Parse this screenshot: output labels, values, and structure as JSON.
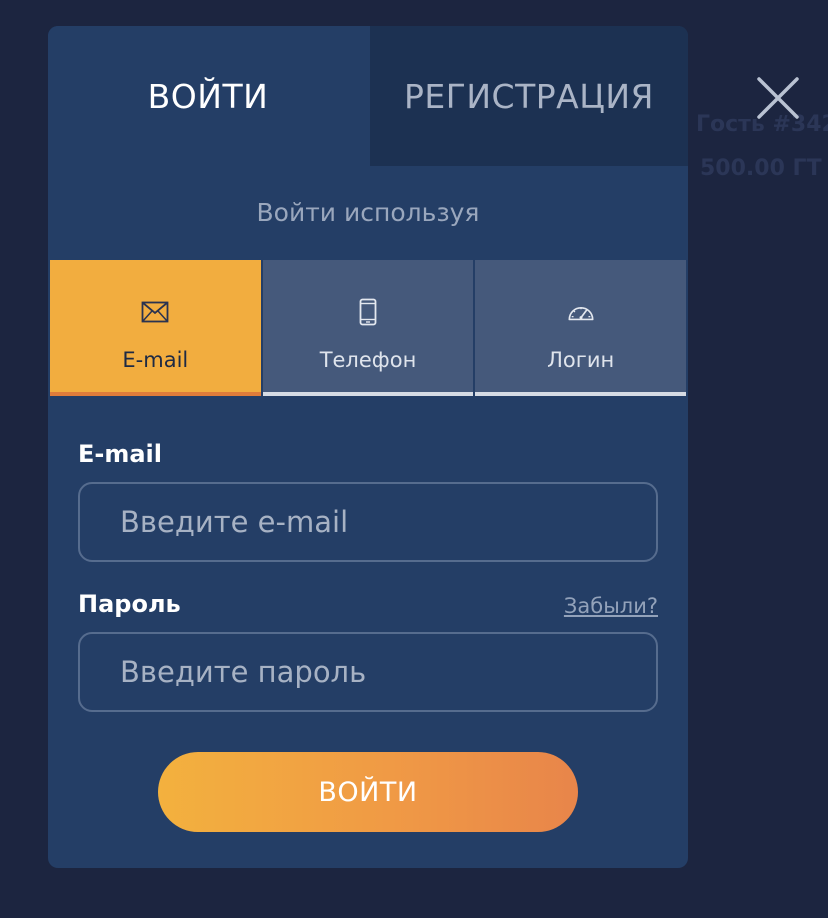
{
  "background": {
    "peek_texts": [
      "Гость #342",
      "500.00 ГТ"
    ]
  },
  "close_icon": "close-x-icon",
  "auth_tabs": {
    "login_label": "ВОЙТИ",
    "register_label": "РЕГИСТРАЦИЯ"
  },
  "use_label": "Войти используя",
  "methods": [
    {
      "label": "E-mail",
      "icon": "envelope-icon",
      "active": true
    },
    {
      "label": "Телефон",
      "icon": "mobile-phone-icon",
      "active": false
    },
    {
      "label": "Логин",
      "icon": "speedometer-icon",
      "active": false
    }
  ],
  "form": {
    "email_label": "E-mail",
    "email_placeholder": "Введите e-mail",
    "email_value": "",
    "password_label": "Пароль",
    "forgot_label": "Забыли?",
    "password_placeholder": "Введите пароль",
    "password_value": "",
    "submit_label": "ВОЙТИ"
  },
  "colors": {
    "modal_bg": "#243e66",
    "inactive_tab_bg": "#1c3152",
    "accent": "#f2ad3f",
    "button_gradient_start": "#f3b13e",
    "button_gradient_end": "#e8854a",
    "page_bg": "#1c2540"
  }
}
